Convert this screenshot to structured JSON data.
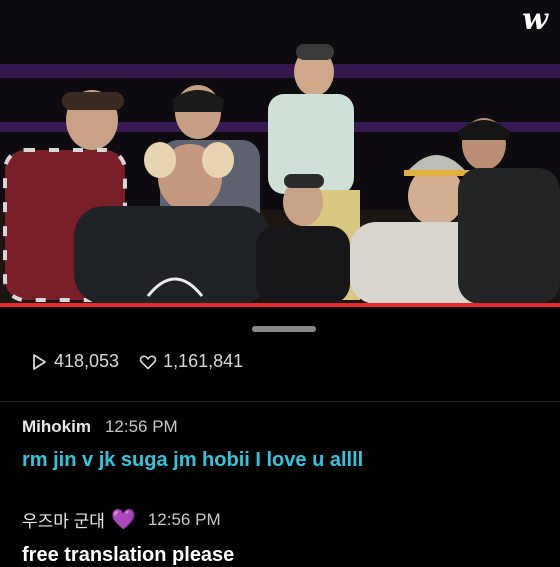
{
  "app": {
    "logo_text": "w"
  },
  "video": {
    "progress": 1.0,
    "scene": "live-broadcast"
  },
  "stats": {
    "plays": "418,053",
    "likes": "1,161,841",
    "play_icon": "play-icon",
    "like_icon": "heart-icon"
  },
  "comments": [
    {
      "user": "Mihokim",
      "time": "12:56 PM",
      "text": "rm jin v jk suga jm hobii I love u allll",
      "text_color": "#30c6de"
    },
    {
      "user": "우즈마 군대",
      "badge": "💜",
      "time": "12:56 PM",
      "text": "free translation please",
      "text_color": "#ffffff"
    }
  ]
}
